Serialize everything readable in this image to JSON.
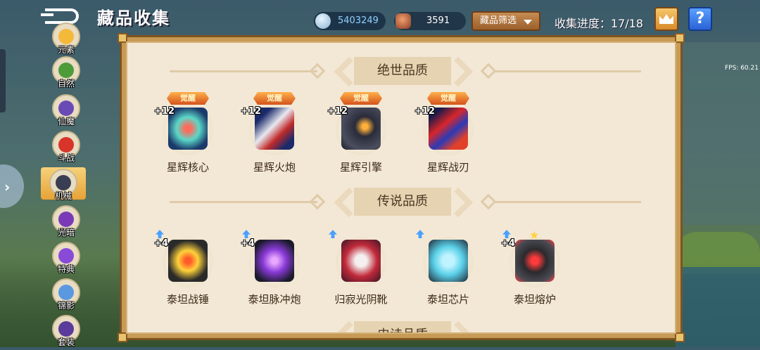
{
  "header": {
    "title": "藏品收集",
    "gem_value": "5403249",
    "ore_value": "3591",
    "filter_label": "藏品筛选",
    "progress_text": "收集进度：17/18",
    "help_label": "?"
  },
  "fps_text": "FPS: 60.21",
  "sidebar": {
    "items": [
      {
        "label": "元素"
      },
      {
        "label": "自然"
      },
      {
        "label": "仙魔"
      },
      {
        "label": "斗战"
      },
      {
        "label": "机械"
      },
      {
        "label": "光暗"
      },
      {
        "label": "特典"
      },
      {
        "label": "锦影"
      },
      {
        "label": "套装"
      }
    ],
    "active_index": 4
  },
  "sections": [
    {
      "label": "绝世品质",
      "items": [
        {
          "name": "星辉核心",
          "badge": "觉醒",
          "level": "+12"
        },
        {
          "name": "星辉火炮",
          "badge": "觉醒",
          "level": "+12"
        },
        {
          "name": "星辉引擎",
          "badge": "觉醒",
          "level": "+12"
        },
        {
          "name": "星辉战刃",
          "badge": "觉醒",
          "level": "+12"
        }
      ]
    },
    {
      "label": "传说品质",
      "items": [
        {
          "name": "泰坦战锤",
          "level": "+4"
        },
        {
          "name": "泰坦脉冲炮",
          "level": "+4"
        },
        {
          "name": "归寂光阴靴",
          "level": ""
        },
        {
          "name": "泰坦芯片",
          "level": ""
        },
        {
          "name": "泰坦熔炉",
          "level": "+4"
        }
      ]
    },
    {
      "label": "史诗品质"
    }
  ]
}
